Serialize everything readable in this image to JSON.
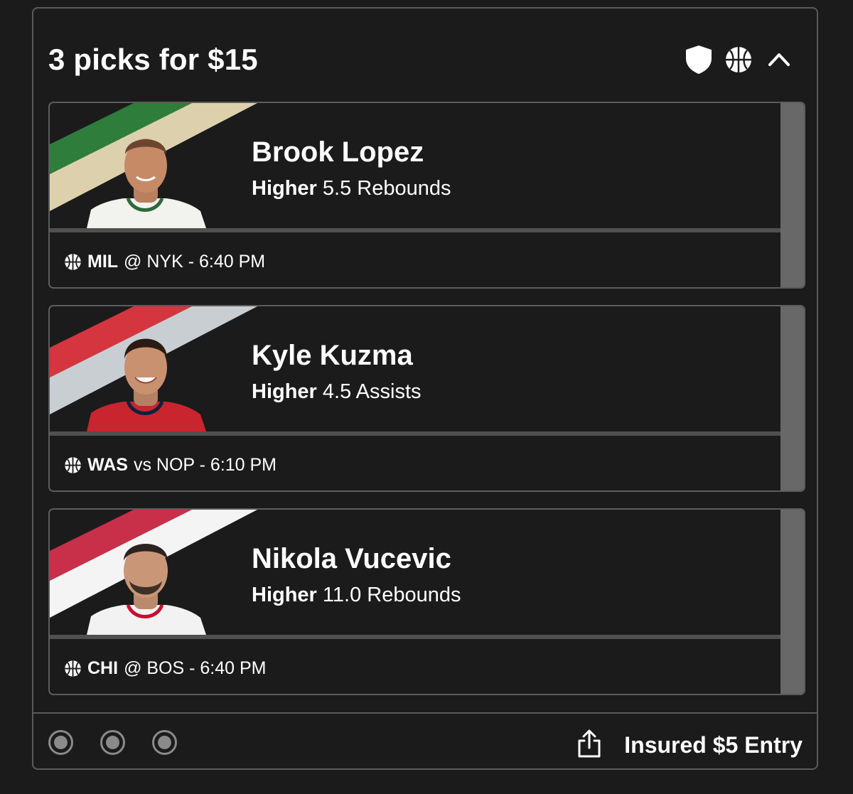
{
  "entry": {
    "title": "3 picks for $15",
    "header_icons": [
      "shield-icon",
      "basketball-icon",
      "chevron-up-icon"
    ],
    "footer": {
      "pick_dots": 3,
      "share_icon": "share-icon",
      "entry_type": "Insured $5 Entry"
    }
  },
  "picks": [
    {
      "player": "Brook Lopez",
      "direction": "Higher",
      "line": "5.5 Rebounds",
      "team": "MIL",
      "matchup": "@ NYK - 6:40 PM",
      "stripe_colors": [
        "#2f7d3b",
        "#ddd1ad"
      ],
      "jersey_color": "#f2f2ef",
      "jersey_trim": "#2d6a3b"
    },
    {
      "player": "Kyle Kuzma",
      "direction": "Higher",
      "line": "4.5 Assists",
      "team": "WAS",
      "matchup": "vs NOP - 6:10 PM",
      "stripe_colors": [
        "#d5353f",
        "#c9ced3"
      ],
      "jersey_color": "#c8252f",
      "jersey_trim": "#0c2340"
    },
    {
      "player": "Nikola Vucevic",
      "direction": "Higher",
      "line": "11.0 Rebounds",
      "team": "CHI",
      "matchup": "@ BOS - 6:40 PM",
      "stripe_colors": [
        "#c8304a",
        "#f4f4f4"
      ],
      "jersey_color": "#f2f2f2",
      "jersey_trim": "#c8102e"
    }
  ]
}
